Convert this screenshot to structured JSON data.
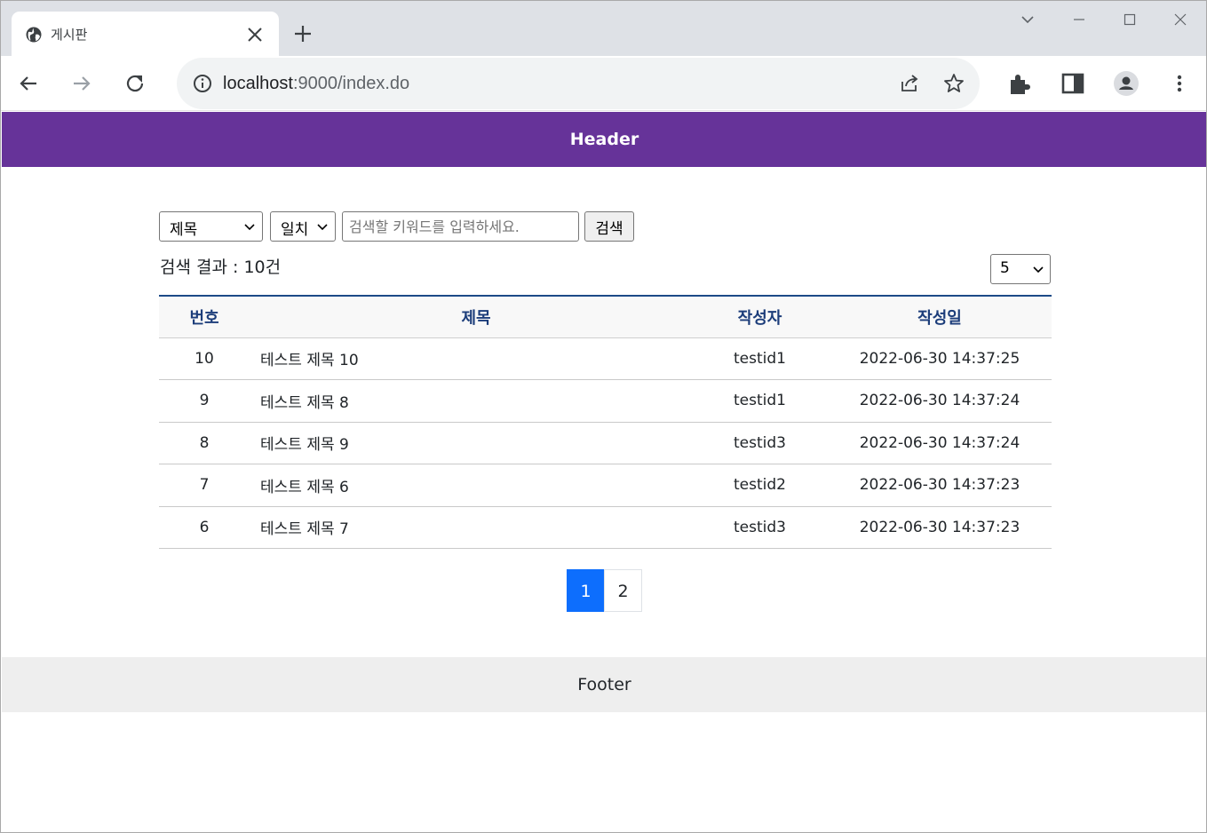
{
  "browser": {
    "tab_title": "게시판",
    "url_host": "localhost",
    "url_path": ":9000/index.do"
  },
  "page": {
    "header_text": "Header",
    "footer_text": "Footer"
  },
  "search": {
    "field_select": "제목",
    "match_select": "일치",
    "placeholder": "검색할 키워드를 입력하세요.",
    "button_label": "검색",
    "result_text": "검색 결과 : 10건",
    "page_size": "5"
  },
  "board": {
    "columns": [
      "번호",
      "제목",
      "작성자",
      "작성일"
    ],
    "rows": [
      {
        "no": "10",
        "title": "테스트 제목 10",
        "writer": "testid1",
        "date": "2022-06-30 14:37:25"
      },
      {
        "no": "9",
        "title": "테스트 제목 8",
        "writer": "testid1",
        "date": "2022-06-30 14:37:24"
      },
      {
        "no": "8",
        "title": "테스트 제목 9",
        "writer": "testid3",
        "date": "2022-06-30 14:37:24"
      },
      {
        "no": "7",
        "title": "테스트 제목 6",
        "writer": "testid2",
        "date": "2022-06-30 14:37:23"
      },
      {
        "no": "6",
        "title": "테스트 제목 7",
        "writer": "testid3",
        "date": "2022-06-30 14:37:23"
      }
    ]
  },
  "pagination": {
    "pages": [
      "1",
      "2"
    ],
    "active": "1"
  },
  "colors": {
    "header_bg": "#663399",
    "active_page": "#0d6efd",
    "table_head_text": "#1c3d7a"
  }
}
